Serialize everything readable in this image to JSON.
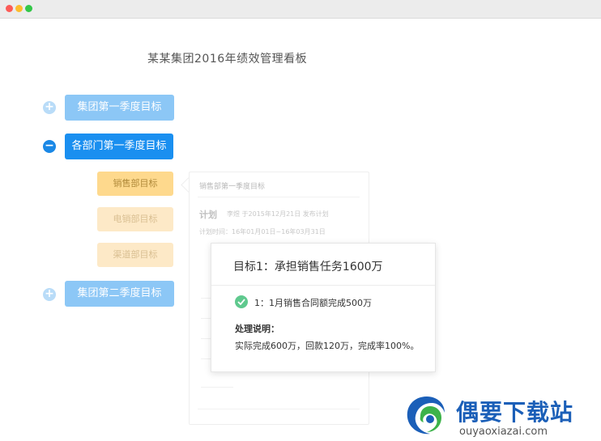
{
  "window": {
    "controls": [
      "close",
      "minimize",
      "maximize"
    ]
  },
  "page_title": "某某集团2016年绩效管理看板",
  "tree": {
    "nodes": [
      {
        "label": "集团第一季度目标",
        "icon": "plus-icon",
        "state": "collapsed"
      },
      {
        "label": "各部门第一季度目标",
        "icon": "minus-icon",
        "state": "expanded"
      },
      {
        "label": "集团第二季度目标",
        "icon": "plus-icon",
        "state": "collapsed"
      }
    ],
    "sub_nodes": [
      {
        "label": "销售部目标"
      },
      {
        "label": "电销部目标"
      },
      {
        "label": "渠道部目标"
      }
    ]
  },
  "faded_panel": {
    "title": "销售部第一季度目标",
    "plan_label": "计划",
    "plan_info": "李煜 于2015年12月21日 发布计划",
    "plan_time": "计划时间：16年01月01日~16年03月31日"
  },
  "popup": {
    "title": "目标1：承担销售任务1600万",
    "item": "1：1月销售合同额完成500万",
    "note_label": "处理说明：",
    "note_text": "实际完成600万，回款120万，完成率100%。"
  },
  "watermark": {
    "name": "偶要下载站",
    "url": "ouyaoxiazai.com"
  },
  "colors": {
    "accent": "#1a8ff0",
    "accent_light": "#8cc7f6",
    "sub_primary": "#fed98d",
    "sub_faded": "#fde9c7",
    "success": "#5fc98e"
  }
}
